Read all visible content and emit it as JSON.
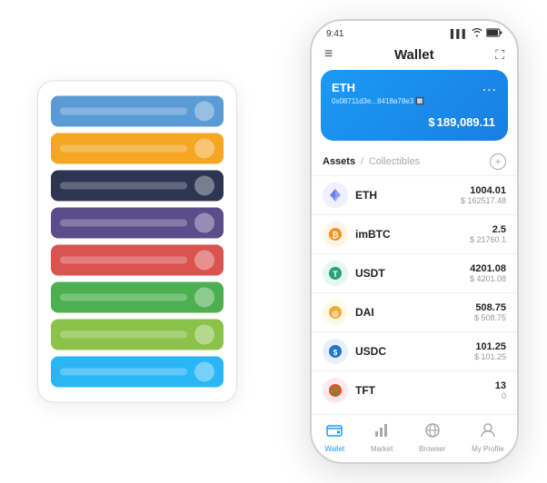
{
  "scene": {
    "card_stack": {
      "cards": [
        {
          "id": "card-blue",
          "color": "#5b9bd5"
        },
        {
          "id": "card-orange",
          "color": "#f5a623"
        },
        {
          "id": "card-dark",
          "color": "#2d3550"
        },
        {
          "id": "card-purple",
          "color": "#5b4d8a"
        },
        {
          "id": "card-red",
          "color": "#d9534f"
        },
        {
          "id": "card-green",
          "color": "#4caf50"
        },
        {
          "id": "card-lightgreen",
          "color": "#8bc34a"
        },
        {
          "id": "card-lightblue",
          "color": "#29b6f6"
        }
      ]
    },
    "phone": {
      "status_bar": {
        "time": "9:41",
        "signal": "▌▌▌",
        "wifi": "wifi",
        "battery": "battery"
      },
      "header": {
        "menu_label": "≡",
        "title": "Wallet",
        "expand_label": "⛶"
      },
      "eth_card": {
        "label": "ETH",
        "more": "...",
        "address": "0x08711d3e...8418a78e3 🔲",
        "currency_symbol": "$",
        "balance": "189,089.11"
      },
      "assets": {
        "tab_active": "Assets",
        "divider": "/",
        "tab_inactive": "Collectibles",
        "add_icon": "+"
      },
      "asset_list": [
        {
          "symbol": "ETH",
          "icon": "◈",
          "icon_color": "#627eea",
          "amount": "1004.01",
          "usd": "$ 162517.48"
        },
        {
          "symbol": "imBTC",
          "icon": "⊙",
          "icon_color": "#f7931a",
          "amount": "2.5",
          "usd": "$ 21760.1"
        },
        {
          "symbol": "USDT",
          "icon": "T",
          "icon_color": "#26a17b",
          "amount": "4201.08",
          "usd": "$ 4201.08"
        },
        {
          "symbol": "DAI",
          "icon": "◎",
          "icon_color": "#f5ac37",
          "amount": "508.75",
          "usd": "$ 508.75"
        },
        {
          "symbol": "USDC",
          "icon": "©",
          "icon_color": "#2775ca",
          "amount": "101.25",
          "usd": "$ 101.25"
        },
        {
          "symbol": "TFT",
          "icon": "🌿",
          "icon_color": "#e74c3c",
          "amount": "13",
          "usd": "0"
        }
      ],
      "nav": [
        {
          "id": "wallet",
          "icon": "◎",
          "label": "Wallet",
          "active": true
        },
        {
          "id": "market",
          "icon": "📊",
          "label": "Market",
          "active": false
        },
        {
          "id": "browser",
          "icon": "🌐",
          "label": "Browser",
          "active": false
        },
        {
          "id": "profile",
          "icon": "👤",
          "label": "My Profile",
          "active": false
        }
      ]
    }
  }
}
